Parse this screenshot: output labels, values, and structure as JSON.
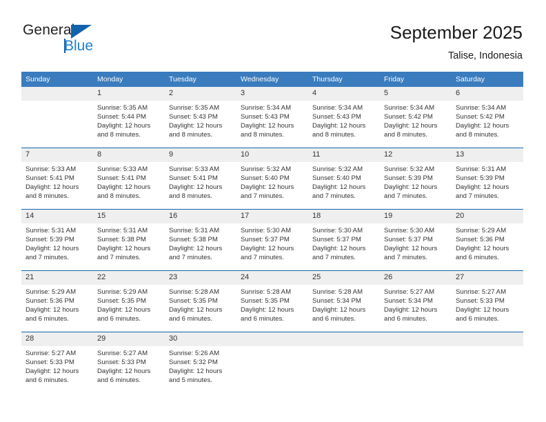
{
  "logo": {
    "word1": "General",
    "word2": "Blue",
    "triangle_color": "#1263ac",
    "blue_color": "#1b80d0"
  },
  "header": {
    "title": "September 2025",
    "subtitle": "Talise, Indonesia"
  },
  "theme": {
    "header_row_bg": "#3a7cbe",
    "row_divider": "#1263ac",
    "daynum_bg": "#efefef",
    "text": "#333333"
  },
  "calendar": {
    "weekday_headers": [
      "Sunday",
      "Monday",
      "Tuesday",
      "Wednesday",
      "Thursday",
      "Friday",
      "Saturday"
    ],
    "weeks": [
      [
        {
          "day": "",
          "sunrise": "",
          "sunset": "",
          "daylight_line1": "",
          "daylight_line2": ""
        },
        {
          "day": "1",
          "sunrise": "Sunrise: 5:35 AM",
          "sunset": "Sunset: 5:44 PM",
          "daylight_line1": "Daylight: 12 hours",
          "daylight_line2": "and 8 minutes."
        },
        {
          "day": "2",
          "sunrise": "Sunrise: 5:35 AM",
          "sunset": "Sunset: 5:43 PM",
          "daylight_line1": "Daylight: 12 hours",
          "daylight_line2": "and 8 minutes."
        },
        {
          "day": "3",
          "sunrise": "Sunrise: 5:34 AM",
          "sunset": "Sunset: 5:43 PM",
          "daylight_line1": "Daylight: 12 hours",
          "daylight_line2": "and 8 minutes."
        },
        {
          "day": "4",
          "sunrise": "Sunrise: 5:34 AM",
          "sunset": "Sunset: 5:43 PM",
          "daylight_line1": "Daylight: 12 hours",
          "daylight_line2": "and 8 minutes."
        },
        {
          "day": "5",
          "sunrise": "Sunrise: 5:34 AM",
          "sunset": "Sunset: 5:42 PM",
          "daylight_line1": "Daylight: 12 hours",
          "daylight_line2": "and 8 minutes."
        },
        {
          "day": "6",
          "sunrise": "Sunrise: 5:34 AM",
          "sunset": "Sunset: 5:42 PM",
          "daylight_line1": "Daylight: 12 hours",
          "daylight_line2": "and 8 minutes."
        }
      ],
      [
        {
          "day": "7",
          "sunrise": "Sunrise: 5:33 AM",
          "sunset": "Sunset: 5:41 PM",
          "daylight_line1": "Daylight: 12 hours",
          "daylight_line2": "and 8 minutes."
        },
        {
          "day": "8",
          "sunrise": "Sunrise: 5:33 AM",
          "sunset": "Sunset: 5:41 PM",
          "daylight_line1": "Daylight: 12 hours",
          "daylight_line2": "and 8 minutes."
        },
        {
          "day": "9",
          "sunrise": "Sunrise: 5:33 AM",
          "sunset": "Sunset: 5:41 PM",
          "daylight_line1": "Daylight: 12 hours",
          "daylight_line2": "and 8 minutes."
        },
        {
          "day": "10",
          "sunrise": "Sunrise: 5:32 AM",
          "sunset": "Sunset: 5:40 PM",
          "daylight_line1": "Daylight: 12 hours",
          "daylight_line2": "and 7 minutes."
        },
        {
          "day": "11",
          "sunrise": "Sunrise: 5:32 AM",
          "sunset": "Sunset: 5:40 PM",
          "daylight_line1": "Daylight: 12 hours",
          "daylight_line2": "and 7 minutes."
        },
        {
          "day": "12",
          "sunrise": "Sunrise: 5:32 AM",
          "sunset": "Sunset: 5:39 PM",
          "daylight_line1": "Daylight: 12 hours",
          "daylight_line2": "and 7 minutes."
        },
        {
          "day": "13",
          "sunrise": "Sunrise: 5:31 AM",
          "sunset": "Sunset: 5:39 PM",
          "daylight_line1": "Daylight: 12 hours",
          "daylight_line2": "and 7 minutes."
        }
      ],
      [
        {
          "day": "14",
          "sunrise": "Sunrise: 5:31 AM",
          "sunset": "Sunset: 5:39 PM",
          "daylight_line1": "Daylight: 12 hours",
          "daylight_line2": "and 7 minutes."
        },
        {
          "day": "15",
          "sunrise": "Sunrise: 5:31 AM",
          "sunset": "Sunset: 5:38 PM",
          "daylight_line1": "Daylight: 12 hours",
          "daylight_line2": "and 7 minutes."
        },
        {
          "day": "16",
          "sunrise": "Sunrise: 5:31 AM",
          "sunset": "Sunset: 5:38 PM",
          "daylight_line1": "Daylight: 12 hours",
          "daylight_line2": "and 7 minutes."
        },
        {
          "day": "17",
          "sunrise": "Sunrise: 5:30 AM",
          "sunset": "Sunset: 5:37 PM",
          "daylight_line1": "Daylight: 12 hours",
          "daylight_line2": "and 7 minutes."
        },
        {
          "day": "18",
          "sunrise": "Sunrise: 5:30 AM",
          "sunset": "Sunset: 5:37 PM",
          "daylight_line1": "Daylight: 12 hours",
          "daylight_line2": "and 7 minutes."
        },
        {
          "day": "19",
          "sunrise": "Sunrise: 5:30 AM",
          "sunset": "Sunset: 5:37 PM",
          "daylight_line1": "Daylight: 12 hours",
          "daylight_line2": "and 7 minutes."
        },
        {
          "day": "20",
          "sunrise": "Sunrise: 5:29 AM",
          "sunset": "Sunset: 5:36 PM",
          "daylight_line1": "Daylight: 12 hours",
          "daylight_line2": "and 6 minutes."
        }
      ],
      [
        {
          "day": "21",
          "sunrise": "Sunrise: 5:29 AM",
          "sunset": "Sunset: 5:36 PM",
          "daylight_line1": "Daylight: 12 hours",
          "daylight_line2": "and 6 minutes."
        },
        {
          "day": "22",
          "sunrise": "Sunrise: 5:29 AM",
          "sunset": "Sunset: 5:35 PM",
          "daylight_line1": "Daylight: 12 hours",
          "daylight_line2": "and 6 minutes."
        },
        {
          "day": "23",
          "sunrise": "Sunrise: 5:28 AM",
          "sunset": "Sunset: 5:35 PM",
          "daylight_line1": "Daylight: 12 hours",
          "daylight_line2": "and 6 minutes."
        },
        {
          "day": "24",
          "sunrise": "Sunrise: 5:28 AM",
          "sunset": "Sunset: 5:35 PM",
          "daylight_line1": "Daylight: 12 hours",
          "daylight_line2": "and 6 minutes."
        },
        {
          "day": "25",
          "sunrise": "Sunrise: 5:28 AM",
          "sunset": "Sunset: 5:34 PM",
          "daylight_line1": "Daylight: 12 hours",
          "daylight_line2": "and 6 minutes."
        },
        {
          "day": "26",
          "sunrise": "Sunrise: 5:27 AM",
          "sunset": "Sunset: 5:34 PM",
          "daylight_line1": "Daylight: 12 hours",
          "daylight_line2": "and 6 minutes."
        },
        {
          "day": "27",
          "sunrise": "Sunrise: 5:27 AM",
          "sunset": "Sunset: 5:33 PM",
          "daylight_line1": "Daylight: 12 hours",
          "daylight_line2": "and 6 minutes."
        }
      ],
      [
        {
          "day": "28",
          "sunrise": "Sunrise: 5:27 AM",
          "sunset": "Sunset: 5:33 PM",
          "daylight_line1": "Daylight: 12 hours",
          "daylight_line2": "and 6 minutes."
        },
        {
          "day": "29",
          "sunrise": "Sunrise: 5:27 AM",
          "sunset": "Sunset: 5:33 PM",
          "daylight_line1": "Daylight: 12 hours",
          "daylight_line2": "and 6 minutes."
        },
        {
          "day": "30",
          "sunrise": "Sunrise: 5:26 AM",
          "sunset": "Sunset: 5:32 PM",
          "daylight_line1": "Daylight: 12 hours",
          "daylight_line2": "and 5 minutes."
        },
        {
          "day": "",
          "sunrise": "",
          "sunset": "",
          "daylight_line1": "",
          "daylight_line2": ""
        },
        {
          "day": "",
          "sunrise": "",
          "sunset": "",
          "daylight_line1": "",
          "daylight_line2": ""
        },
        {
          "day": "",
          "sunrise": "",
          "sunset": "",
          "daylight_line1": "",
          "daylight_line2": ""
        },
        {
          "day": "",
          "sunrise": "",
          "sunset": "",
          "daylight_line1": "",
          "daylight_line2": ""
        }
      ]
    ]
  }
}
